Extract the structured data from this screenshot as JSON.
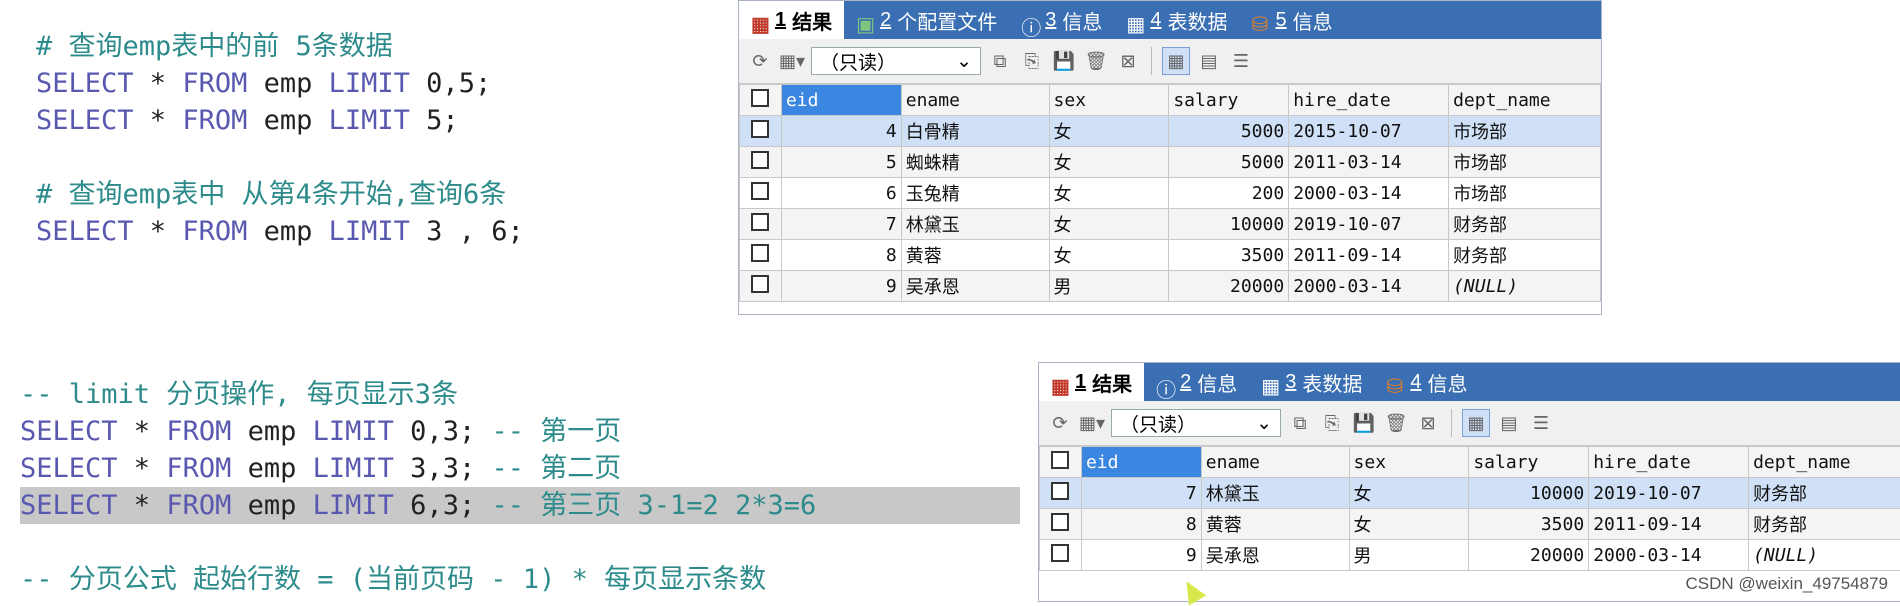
{
  "top_code": [
    {
      "type": "comment",
      "text": "# 查询emp表中的前 5条数据"
    },
    {
      "type": "sql",
      "kw1": "SELECT",
      "star": " * ",
      "kw2": "FROM",
      "mid": " emp ",
      "kw3": "LIMIT",
      "rest": " 0,5;"
    },
    {
      "type": "sql",
      "kw1": "SELECT",
      "star": " * ",
      "kw2": "FROM",
      "mid": " emp ",
      "kw3": "LIMIT",
      "rest": " 5;"
    },
    {
      "type": "blank",
      "text": ""
    },
    {
      "type": "comment",
      "text": "# 查询emp表中 从第4条开始,查询6条"
    },
    {
      "type": "sql",
      "kw1": "SELECT",
      "star": " * ",
      "kw2": "FROM",
      "mid": " emp ",
      "kw3": "LIMIT",
      "rest": " 3 , 6;"
    }
  ],
  "bottom_code": [
    {
      "type": "comment",
      "text": "-- limit 分页操作, 每页显示3条"
    },
    {
      "type": "sql",
      "kw1": "SELECT",
      "star": " * ",
      "kw2": "FROM",
      "mid": " emp ",
      "kw3": "LIMIT",
      "rest": " 0,3; ",
      "c": "-- 第一页"
    },
    {
      "type": "sql",
      "kw1": "SELECT",
      "star": " * ",
      "kw2": "FROM",
      "mid": " emp ",
      "kw3": "LIMIT",
      "rest": " 3,3; ",
      "c": "-- 第二页"
    },
    {
      "type": "sql",
      "hl": true,
      "kw1": "SELECT",
      "star": " * ",
      "kw2": "FROM",
      "mid": " emp ",
      "kw3": "LIMIT",
      "rest": " 6,3; ",
      "c": "-- 第三页 3-1=2 2*3=6"
    },
    {
      "type": "blank",
      "text": ""
    },
    {
      "type": "comment",
      "text": "-- 分页公式 起始行数 = (当前页码 - 1) * 每页显示条数"
    }
  ],
  "panel1": {
    "tabs": [
      {
        "num": "1",
        "label": " 结果",
        "active": true,
        "icon": "grid-icon"
      },
      {
        "num": "2",
        "label": " 个配置文件",
        "active": false,
        "icon": "profile-icon"
      },
      {
        "num": "3",
        "label": " 信息",
        "active": false,
        "icon": "info-icon"
      },
      {
        "num": "4",
        "label": " 表数据",
        "active": false,
        "icon": "table-icon"
      },
      {
        "num": "5",
        "label": " 信息",
        "active": false,
        "icon": "db-icon"
      }
    ],
    "mode": "（只读）",
    "columns": [
      "eid",
      "ename",
      "sex",
      "salary",
      "hire_date",
      "dept_name"
    ],
    "rows": [
      {
        "eid": "4",
        "ename": "白骨精",
        "sex": "女",
        "salary": "5000",
        "hire_date": "2015-10-07",
        "dept_name": "市场部"
      },
      {
        "eid": "5",
        "ename": "蜘蛛精",
        "sex": "女",
        "salary": "5000",
        "hire_date": "2011-03-14",
        "dept_name": "市场部"
      },
      {
        "eid": "6",
        "ename": "玉兔精",
        "sex": "女",
        "salary": "200",
        "hire_date": "2000-03-14",
        "dept_name": "市场部"
      },
      {
        "eid": "7",
        "ename": "林黛玉",
        "sex": "女",
        "salary": "10000",
        "hire_date": "2019-10-07",
        "dept_name": "财务部"
      },
      {
        "eid": "8",
        "ename": "黄蓉",
        "sex": "女",
        "salary": "3500",
        "hire_date": "2011-09-14",
        "dept_name": "财务部"
      },
      {
        "eid": "9",
        "ename": "吴承恩",
        "sex": "男",
        "salary": "20000",
        "hire_date": "2000-03-14",
        "dept_name": "(NULL)"
      }
    ]
  },
  "panel2": {
    "tabs": [
      {
        "num": "1",
        "label": " 结果",
        "active": true,
        "icon": "grid-icon"
      },
      {
        "num": "2",
        "label": " 信息",
        "active": false,
        "icon": "info-icon"
      },
      {
        "num": "3",
        "label": " 表数据",
        "active": false,
        "icon": "table-icon"
      },
      {
        "num": "4",
        "label": " 信息",
        "active": false,
        "icon": "db-icon"
      }
    ],
    "mode": "（只读）",
    "columns": [
      "eid",
      "ename",
      "sex",
      "salary",
      "hire_date",
      "dept_name"
    ],
    "rows": [
      {
        "eid": "7",
        "ename": "林黛玉",
        "sex": "女",
        "salary": "10000",
        "hire_date": "2019-10-07",
        "dept_name": "财务部"
      },
      {
        "eid": "8",
        "ename": "黄蓉",
        "sex": "女",
        "salary": "3500",
        "hire_date": "2011-09-14",
        "dept_name": "财务部"
      },
      {
        "eid": "9",
        "ename": "吴承恩",
        "sex": "男",
        "salary": "20000",
        "hire_date": "2000-03-14",
        "dept_name": "(NULL)"
      }
    ]
  },
  "watermark": "CSDN @weixin_49754879"
}
